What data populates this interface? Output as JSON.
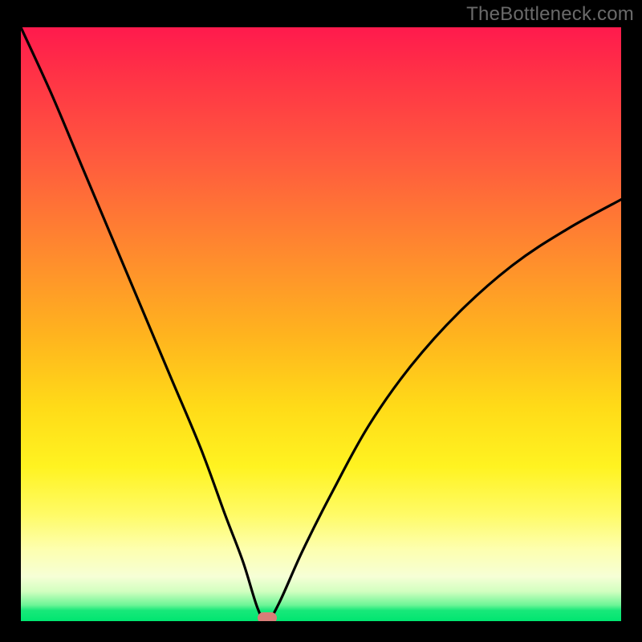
{
  "watermark": "TheBottleneck.com",
  "chart_data": {
    "type": "line",
    "title": "",
    "xlabel": "",
    "ylabel": "",
    "xlim": [
      0,
      100
    ],
    "ylim": [
      0,
      100
    ],
    "grid": false,
    "legend": false,
    "background": "rainbow-vertical-gradient",
    "series": [
      {
        "name": "bottleneck-curve",
        "x": [
          0,
          5,
          10,
          15,
          20,
          25,
          30,
          34,
          37,
          39.5,
          41,
          43,
          47,
          52,
          58,
          65,
          73,
          82,
          91,
          100
        ],
        "values": [
          100,
          89,
          77,
          65,
          53,
          41,
          29,
          18,
          10,
          2,
          0,
          3,
          12,
          22,
          33,
          43,
          52,
          60,
          66,
          71
        ]
      }
    ],
    "marker": {
      "x": 41,
      "y": 0,
      "color": "#d87d78"
    },
    "colors": {
      "curve": "#000000",
      "frame": "#000000",
      "gradient_stops": [
        "#ff1a4d",
        "#ff8a2e",
        "#ffdb18",
        "#fdffb0",
        "#00e670"
      ]
    }
  }
}
